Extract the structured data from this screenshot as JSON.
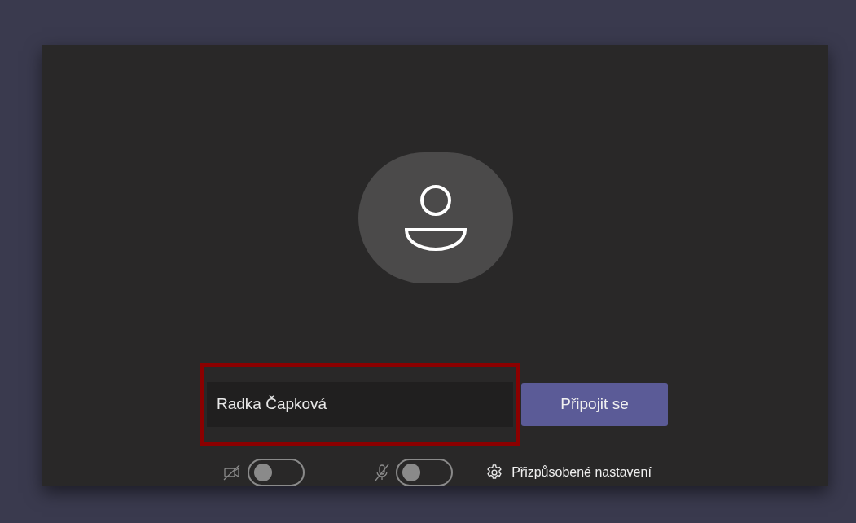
{
  "name_field": {
    "value": "Radka Čapková",
    "highlighted": true
  },
  "join_button": {
    "label": "Připojit se"
  },
  "toggles": [
    {
      "kind": "camera",
      "on": false
    },
    {
      "kind": "microphone",
      "on": false
    }
  ],
  "settings_link": {
    "label": "Přizpůsobené nastavení"
  }
}
